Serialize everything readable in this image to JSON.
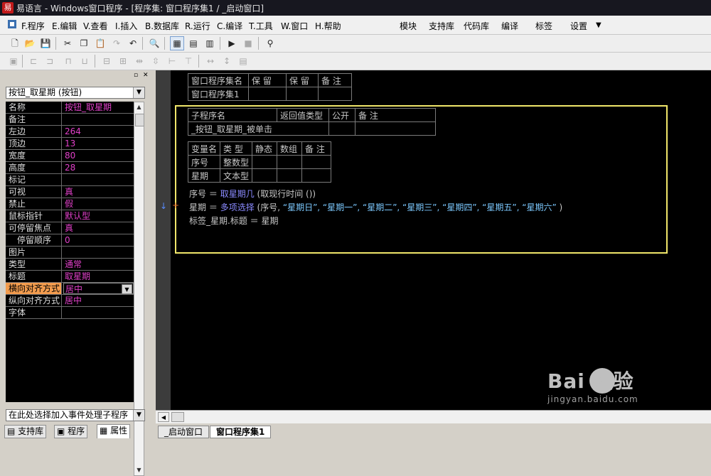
{
  "window": {
    "app_icon": "易",
    "title": "易语言 - Windows窗口程序 - [程序集: 窗口程序集1 / _启动窗口]"
  },
  "menu": {
    "items": [
      "F.程序",
      "E.编辑",
      "V.查看",
      "I.插入",
      "B.数据库",
      "R.运行",
      "C.编译",
      "T.工具",
      "W.窗口",
      "H.帮助"
    ],
    "right_items": [
      "模块",
      "支持库",
      "代码库",
      "编译",
      "标签",
      "设置"
    ]
  },
  "toolbar1": {
    "icons": [
      "new-icon",
      "open-icon",
      "save-icon",
      "cut-icon",
      "copy-icon",
      "paste-icon",
      "redo-icon",
      "undo-icon",
      "find-icon",
      "layout1-icon",
      "layout2-icon",
      "layout3-icon",
      "run-icon",
      "stop-icon",
      "binoculars-icon"
    ]
  },
  "left_panel": {
    "component_select": "按钮_取星期 (按钮)",
    "properties": [
      {
        "name": "名称",
        "value": "按钮_取星期"
      },
      {
        "name": "备注",
        "value": ""
      },
      {
        "name": "左边",
        "value": "264"
      },
      {
        "name": "顶边",
        "value": "13"
      },
      {
        "name": "宽度",
        "value": "80"
      },
      {
        "name": "高度",
        "value": "28"
      },
      {
        "name": "标记",
        "value": ""
      },
      {
        "name": "可视",
        "value": "真"
      },
      {
        "name": "禁止",
        "value": "假"
      },
      {
        "name": "鼠标指针",
        "value": "默认型"
      },
      {
        "name": "可停留焦点",
        "value": "真"
      },
      {
        "name": "停留顺序",
        "value": "0"
      },
      {
        "name": "图片",
        "value": ""
      },
      {
        "name": "类型",
        "value": "通常"
      },
      {
        "name": "标题",
        "value": "取星期"
      },
      {
        "name": "横向对齐方式",
        "value": "居中"
      },
      {
        "name": "纵向对齐方式",
        "value": "居中"
      },
      {
        "name": "字体",
        "value": ""
      }
    ],
    "event_select": "在此处选择加入事件处理子程序",
    "tabs": [
      "支持库",
      "程序",
      "属性"
    ]
  },
  "editor": {
    "assembly_table": {
      "headers": [
        "窗口程序集名",
        "保 留",
        "保 留",
        "备 注"
      ],
      "row": [
        "窗口程序集1",
        "",
        "",
        ""
      ]
    },
    "sub_table": {
      "headers": [
        "子程序名",
        "返回值类型",
        "公开",
        "备 注"
      ],
      "row": [
        "_按钮_取星期_被单击",
        "",
        "",
        ""
      ]
    },
    "var_table": {
      "headers": [
        "变量名",
        "类 型",
        "静态",
        "数组",
        "备 注"
      ],
      "rows": [
        [
          "序号",
          "整数型",
          "",
          "",
          ""
        ],
        [
          "星期",
          "文本型",
          "",
          "",
          ""
        ]
      ]
    },
    "code_lines": {
      "l1_var": "序号",
      "l1_eq": "＝",
      "l1_func": "取星期几",
      "l1_args": "(取现行时间 ())",
      "l2_var": "星期",
      "l2_eq": "＝",
      "l2_func": "多项选择",
      "l2_open": "(序号,",
      "l2_strs": "“星期日”, “星期一”, “星期二”, “星期三”, “星期四”, “星期五”, “星期六”",
      "l2_close": ")",
      "l3": "标签_星期.标题 ＝ 星期"
    },
    "markers": {
      "arrow": "↓",
      "plus": "+"
    }
  },
  "doc_tabs": [
    "_启动窗口",
    "窗口程序集1"
  ],
  "watermark": {
    "main": "Bai 经验",
    "sub": "jingyan.baidu.com"
  }
}
